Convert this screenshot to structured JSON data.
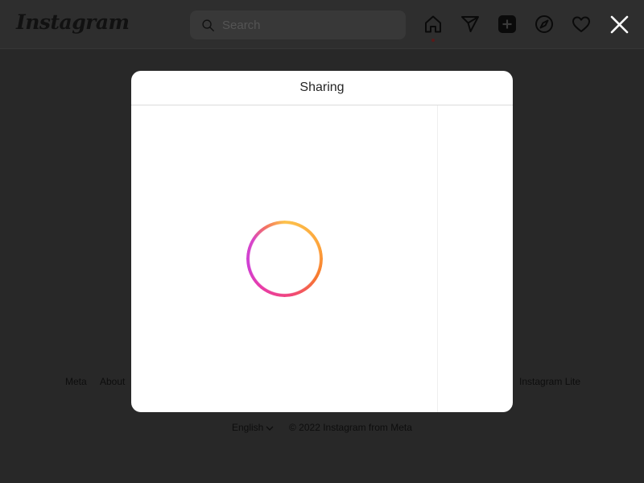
{
  "topbar": {
    "logo_text": "Instagram",
    "search": {
      "placeholder": "Search",
      "value": ""
    },
    "icons": [
      "home-icon",
      "direct-send-icon",
      "new-post-icon",
      "explore-compass-icon",
      "activity-heart-icon"
    ]
  },
  "modal": {
    "title": "Sharing",
    "status": "loading"
  },
  "close_icon": "close-icon",
  "footer": {
    "links_visible": [
      "Meta",
      "About",
      "Instagram Lite"
    ],
    "language": "English",
    "copyright": "© 2022 Instagram from Meta"
  },
  "colors": {
    "overlay_bg": "#282828",
    "modal_bg": "#ffffff",
    "spinner_gradient": [
      "#fcc24c",
      "#f7782e",
      "#f0457a",
      "#cf3fd4"
    ]
  }
}
